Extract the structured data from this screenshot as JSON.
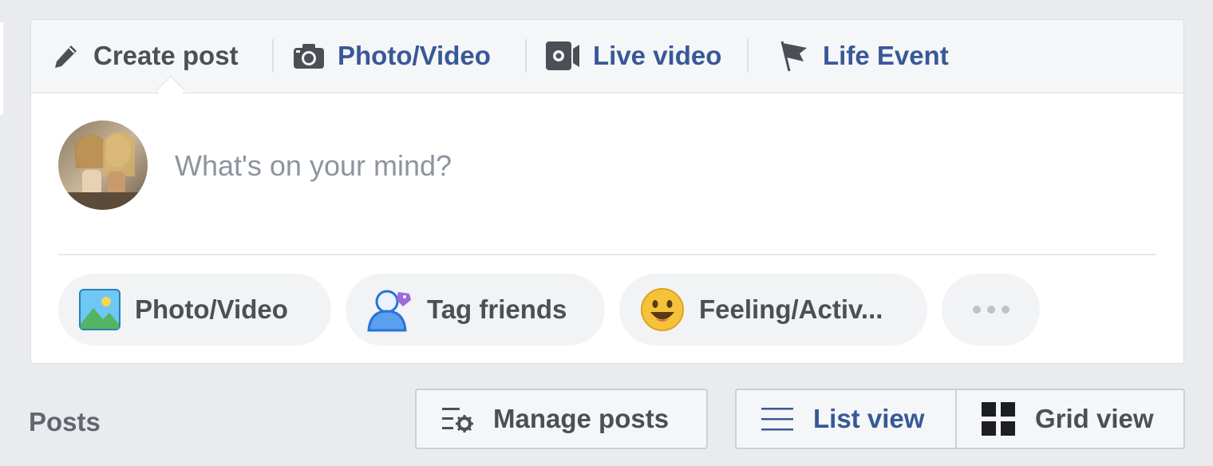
{
  "composer": {
    "tabs": [
      {
        "label": "Create post",
        "icon": "pencil-icon"
      },
      {
        "label": "Photo/Video",
        "icon": "camera-icon"
      },
      {
        "label": "Live video",
        "icon": "video-camera-icon"
      },
      {
        "label": "Life Event",
        "icon": "flag-icon"
      }
    ],
    "placeholder": "What's on your mind?",
    "actions": [
      {
        "label": "Photo/Video",
        "icon": "photo-icon"
      },
      {
        "label": "Tag friends",
        "icon": "tag-friends-icon"
      },
      {
        "label": "Feeling/Activ...",
        "icon": "smiley-icon"
      },
      {
        "label": "",
        "icon": "more-dots-icon"
      }
    ]
  },
  "posts_bar": {
    "title": "Posts",
    "manage_label": "Manage posts",
    "list_view_label": "List view",
    "grid_view_label": "Grid view"
  },
  "colors": {
    "link_blue": "#385898",
    "text_gray": "#4b4f56",
    "page_bg": "#e9ebee",
    "placeholder_gray": "#8d949e"
  }
}
